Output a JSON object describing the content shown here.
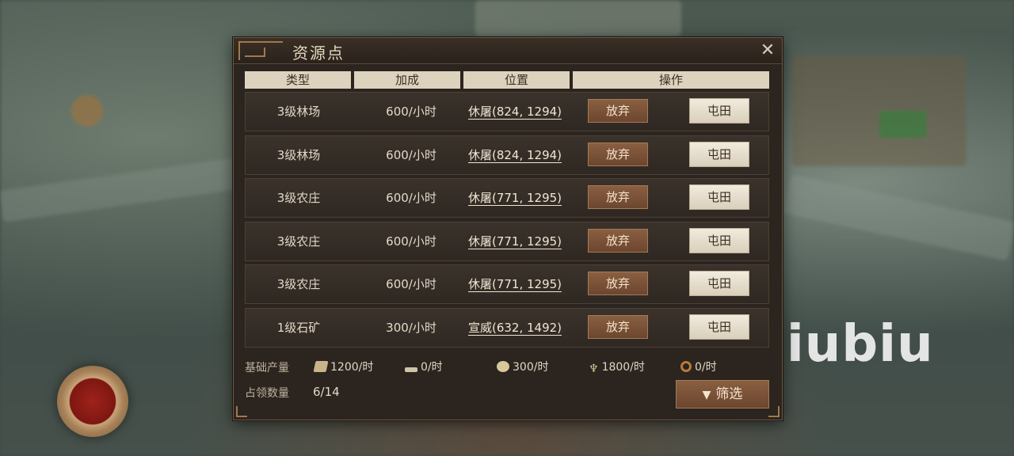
{
  "panel": {
    "title": "资源点",
    "close_glyph": "✕"
  },
  "table": {
    "headers": [
      "类型",
      "加成",
      "位置",
      "操作"
    ],
    "rows": [
      {
        "type": "3级林场",
        "rate": "600/小时",
        "location": "休屠(824, 1294)",
        "abandon": "放弃",
        "farm": "屯田"
      },
      {
        "type": "3级林场",
        "rate": "600/小时",
        "location": "休屠(824, 1294)",
        "abandon": "放弃",
        "farm": "屯田"
      },
      {
        "type": "3级农庄",
        "rate": "600/小时",
        "location": "休屠(771, 1295)",
        "abandon": "放弃",
        "farm": "屯田"
      },
      {
        "type": "3级农庄",
        "rate": "600/小时",
        "location": "休屠(771, 1295)",
        "abandon": "放弃",
        "farm": "屯田"
      },
      {
        "type": "3级农庄",
        "rate": "600/小时",
        "location": "休屠(771, 1295)",
        "abandon": "放弃",
        "farm": "屯田"
      },
      {
        "type": "1级石矿",
        "rate": "300/小时",
        "location": "宣威(632, 1492)",
        "abandon": "放弃",
        "farm": "屯田"
      }
    ]
  },
  "footer": {
    "base_label": "基础产量",
    "resources": [
      {
        "icon": "wood-icon",
        "value": "1200/时"
      },
      {
        "icon": "iron-icon",
        "value": "0/时"
      },
      {
        "icon": "stone-icon",
        "value": "300/时"
      },
      {
        "icon": "grain-icon",
        "value": "1800/时"
      },
      {
        "icon": "coin-icon",
        "value": "0/时"
      }
    ],
    "occupy_label": "占领数量",
    "occupy_value": "6/14",
    "filter_label": "筛选"
  },
  "watermark": "biubiu"
}
